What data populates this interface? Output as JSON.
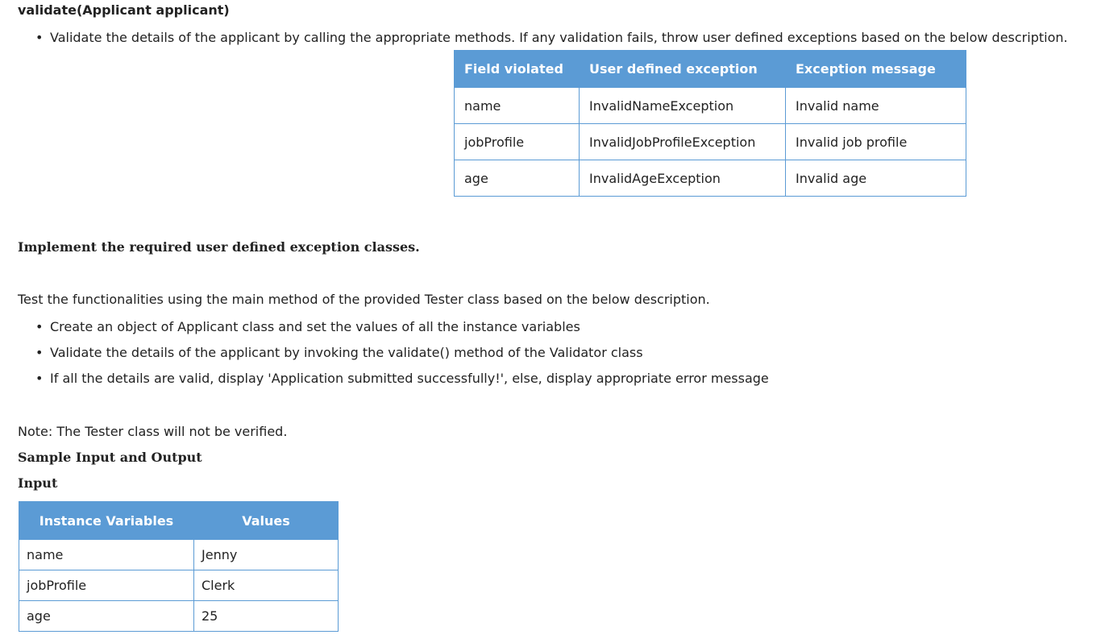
{
  "method_heading": "validate(Applicant applicant)",
  "validate_bullet": "Validate the details of the applicant by calling the appropriate methods. If any validation fails, throw user defined exceptions based on the below description.",
  "exception_table": {
    "headers": [
      "Field violated",
      "User defined exception",
      "Exception message"
    ],
    "rows": [
      [
        "name",
        "InvalidNameException",
        "Invalid name"
      ],
      [
        "jobProfile",
        "InvalidJobProfileException",
        "Invalid job profile"
      ],
      [
        "age",
        "InvalidAgeException",
        "Invalid age"
      ]
    ]
  },
  "implement_heading": "Implement the required user defined exception classes.",
  "test_intro": "Test the functionalities using the main method of the provided Tester class based on the below description.",
  "test_bullets": [
    "Create an object of Applicant class and set the values of all the instance variables",
    "Validate the details of the applicant by invoking the validate() method of the Validator class",
    "If all the details are valid, display 'Application submitted successfully!', else, display appropriate error message"
  ],
  "note": "Note: The Tester class will not be verified.",
  "sample_heading": "Sample Input and Output",
  "input_heading": "Input",
  "input_table": {
    "headers": [
      "Instance Variables",
      "Values"
    ],
    "rows": [
      [
        "name",
        "Jenny"
      ],
      [
        "jobProfile",
        "Clerk"
      ],
      [
        "age",
        "25"
      ]
    ]
  }
}
